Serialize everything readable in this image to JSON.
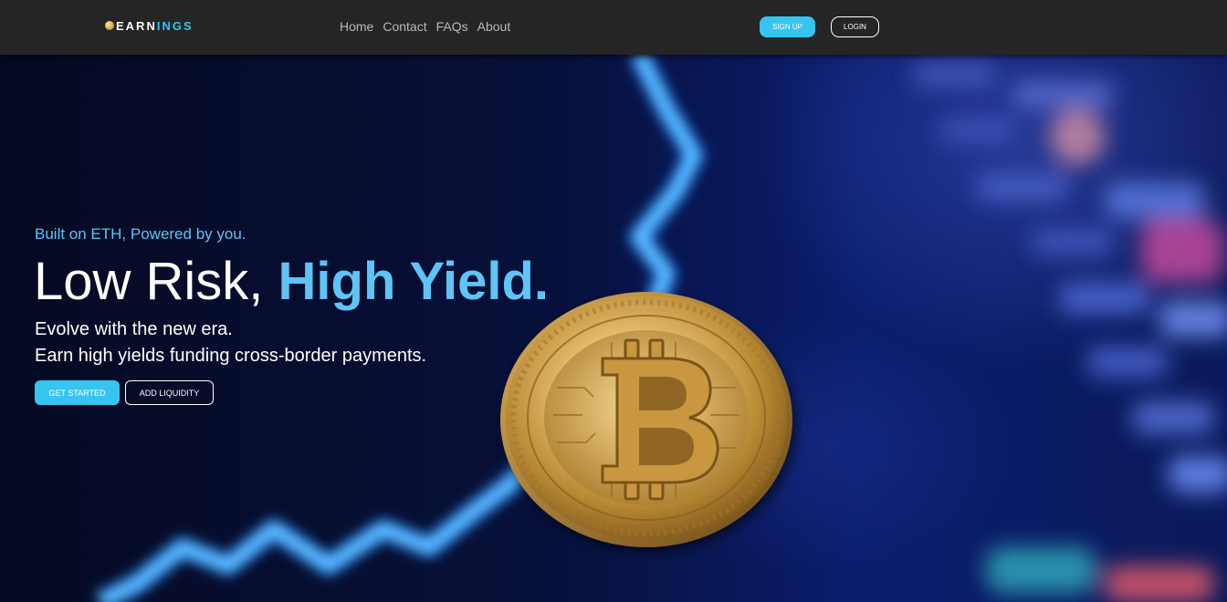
{
  "navbar": {
    "logo_prefix": "EARN",
    "logo_accent": "INGS",
    "links": [
      "Home",
      "Contact",
      "FAQs",
      "About"
    ],
    "signup_label": "SIGN UP",
    "login_label": "LOGIN"
  },
  "hero": {
    "tagline": "Built on ETH, Powered by you.",
    "headline_plain": "Low Risk, ",
    "headline_accent": "High Yield.",
    "subtitle_line1": "Evolve with the new era.",
    "subtitle_line2": "Earn high yields funding cross-border payments.",
    "primary_button": "GET STARTED",
    "secondary_button": "ADD LIQUIDITY",
    "image_icon": "bitcoin-coin-icon"
  },
  "colors": {
    "accent": "#36c5f0",
    "headline_accent": "#5ec4f5",
    "navbar_bg": "#252525"
  }
}
